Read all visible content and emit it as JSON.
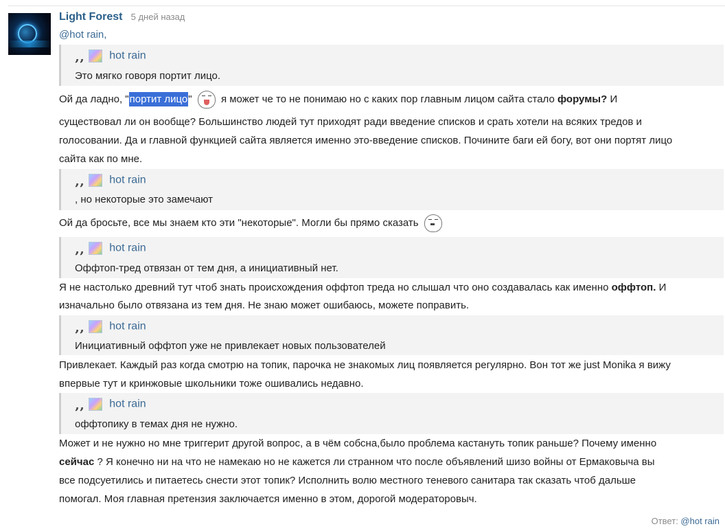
{
  "post": {
    "author": "Light Forest",
    "time": "5 дней назад",
    "mention": "@hot rain,"
  },
  "quotes": [
    {
      "author": "hot rain",
      "text": "Это мягко говоря портит лицо."
    },
    {
      "author": "hot rain",
      "text": ", но некоторые это замечают"
    },
    {
      "author": "hot rain",
      "text": "Оффтоп-тред отвязан от тем дня, а инициативный нет."
    },
    {
      "author": "hot rain",
      "text": "Инициативный оффтоп уже не привлекает новых пользователей"
    },
    {
      "author": "hot rain",
      "text": "оффтопику в темах дня не нужно."
    }
  ],
  "paragraphs": {
    "p1": {
      "a": "Ой да ладно, \"",
      "highlight": "портит лицо",
      "b": "\"",
      "c": " я может че то не понимаю но с каких пор главным лицом сайта стало ",
      "bold": "форумы?",
      "d": " И"
    },
    "p1_line2": "существовал ли он вообще? Большинство людей тут приходят ради введение списков и срать хотели на всяких тредов и",
    "p1_line3": "голосовании. Да и главной функцией сайта является именно это-введение списков. Почините баги ей богу, вот они портят лицо",
    "p1_line4": "сайта как по мне.",
    "p2": "Ой да бросьте, все мы знаем кто эти \"некоторые\". Могли бы прямо сказать",
    "p3_line1_a": "Я не настолько древний тут чтоб знать происхождения оффтоп треда но слышал что оно создавалась как именно ",
    "p3_line1_bold": "оффтоп.",
    "p3_line1_b": " И",
    "p3_line2": "изначально было отвязана из тем дня. Не знаю может ошибаюсь, можете поправить.",
    "p4_line1": "Привлекает. Каждый раз когда смотрю на топик, парочка не знакомых лиц появляется регулярно. Вон тот же just Monika я вижу",
    "p4_line2": "впервые тут и кринжовые школьники тоже ошивались недавно.",
    "p5_line1": "Может и не нужно но мне триггерит другой вопрос, а в чём собсна,было проблема кастануть топик раньше? Почему именно",
    "p5_line2_bold": "сейчас",
    "p5_line2": " ? Я конечно ни на что не намекаю но не кажется ли странном что после объявлений шизо войны от Ермаковыча вы",
    "p5_line3": "все подсуетились и питаетесь снести этот топик? Исполнить волю местного теневого санитара так сказать чтоб дальше",
    "p5_line4": "помогал. Моя главная претензия заключается именно в этом, дорогой модераторовыч."
  },
  "footer": {
    "label": "Ответ: ",
    "at": "@",
    "user": "hot rain"
  },
  "icons": {
    "avatar": "user-avatar-image",
    "quote": "quote-mark-icon",
    "smiley": "emoticon-icon"
  }
}
